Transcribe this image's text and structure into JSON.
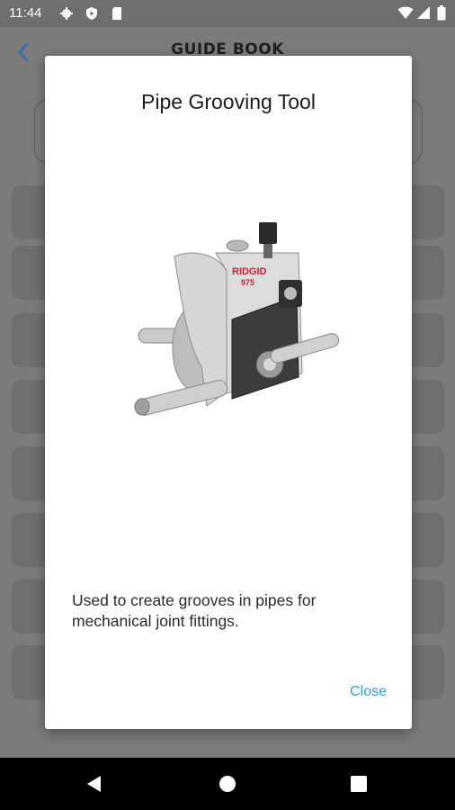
{
  "status_bar": {
    "time": "11:44",
    "left_icons": [
      "settings-icon",
      "shield-icon",
      "sd-card-icon"
    ],
    "right_icons": [
      "wifi-icon",
      "signal-icon",
      "battery-icon"
    ]
  },
  "app": {
    "title": "GUIDE BOOK",
    "back_icon": "chevron-left-icon",
    "accent_color": "#2f6fb0"
  },
  "dialog": {
    "title": "Pipe Grooving Tool",
    "image_brand": "RIDGID",
    "image_model": "975",
    "description": "Used to create grooves in pipes for mechanical joint fittings.",
    "close_label": "Close",
    "close_color": "#2f9fe0"
  },
  "nav_bar": {
    "buttons": [
      "back-triangle-icon",
      "home-circle-icon",
      "recents-square-icon"
    ]
  }
}
